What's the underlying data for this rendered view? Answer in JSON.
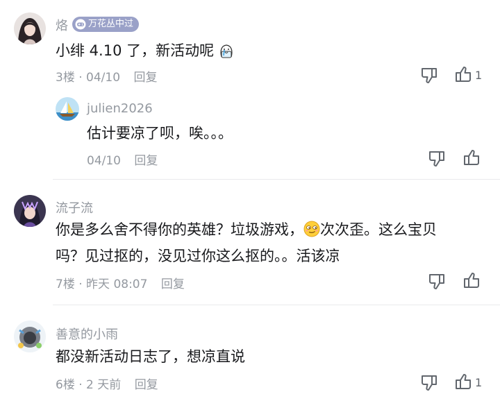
{
  "comments": [
    {
      "username": "烙",
      "badge": "万花丛中过",
      "content": "小绯 4.10 了，新活动呢",
      "floor": "3楼",
      "time": "04/10",
      "reply_label": "回复",
      "likes": "1",
      "reply": {
        "username": "julien2026",
        "content": "估计要凉了呗，唉。。。",
        "time": "04/10",
        "reply_label": "回复"
      }
    },
    {
      "username": "流子流",
      "content_line1_a": "你是多么舍不得你的英雄？垃圾游戏，",
      "content_line1_b": "次次歪。这么宝贝",
      "content_line2": "吗？见过抠的，没见过你这么抠的。。活该凉",
      "floor": "7楼",
      "time": "昨天 08:07",
      "reply_label": "回复"
    },
    {
      "username": "善意的小雨",
      "content": "都没新活动日志了，想凉直说",
      "floor": "6楼",
      "time": "2 天前",
      "reply_label": "回复",
      "likes": "1"
    }
  ],
  "separator": "·",
  "icons": {
    "dislike": "thumbs-down-icon",
    "like": "thumbs-up-icon",
    "badge": "gamepad-icon",
    "emoji_tears": "crying-face-emoji",
    "emoji_smug": "smug-face-emoji"
  },
  "colors": {
    "meta": "#9499a0",
    "text": "#18191c",
    "badge": "#9aa1c8",
    "divider": "#e9eaec"
  }
}
